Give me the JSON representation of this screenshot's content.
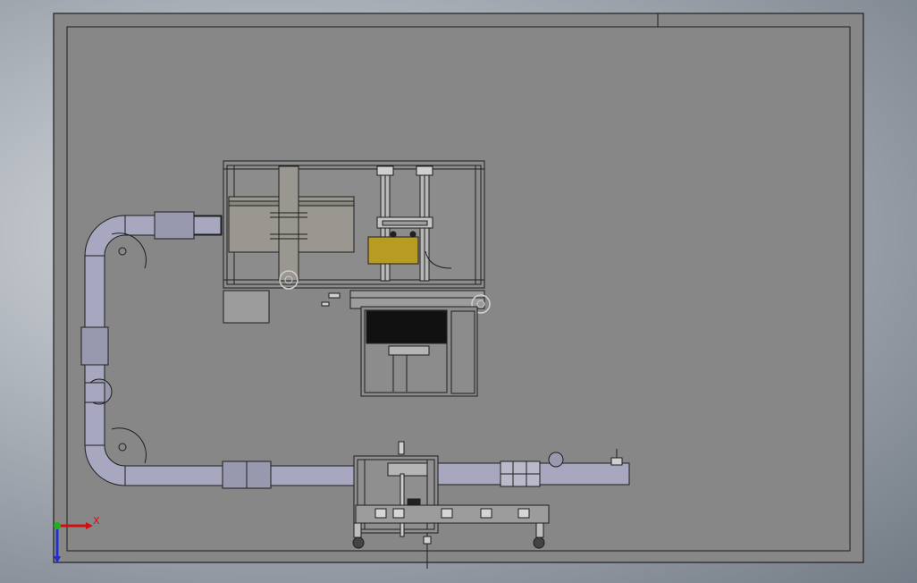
{
  "viewport": {
    "background_colors": [
      "#d8dbe0",
      "#737b86"
    ]
  },
  "drawing": {
    "sheet_color": "#878787",
    "line_color": "#1e1e1e",
    "pipe_color": "#a7a7bf",
    "highlight_color": "#b89b23"
  },
  "triad": {
    "x_label": "X",
    "x_color": "#d01010",
    "y_color": "#20b020",
    "z_color": "#2030d0"
  }
}
